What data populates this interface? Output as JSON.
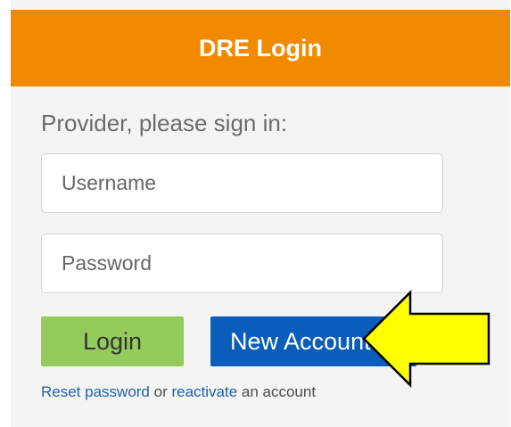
{
  "header": {
    "title": "DRE Login"
  },
  "form": {
    "prompt": "Provider, please sign in:",
    "username_placeholder": "Username",
    "password_placeholder": "Password",
    "login_label": "Login",
    "new_account_label": "New Account"
  },
  "footer": {
    "reset_link": "Reset password",
    "or_text": " or ",
    "reactivate_link": "reactivate",
    "tail_text": " an account"
  },
  "colors": {
    "header_bg": "#f28a00",
    "login_bg": "#94cc5c",
    "new_account_bg": "#0a5dba",
    "arrow_fill": "#ffff00",
    "link": "#1f5fa8"
  },
  "annotation": {
    "icon": "arrow-left-icon"
  }
}
